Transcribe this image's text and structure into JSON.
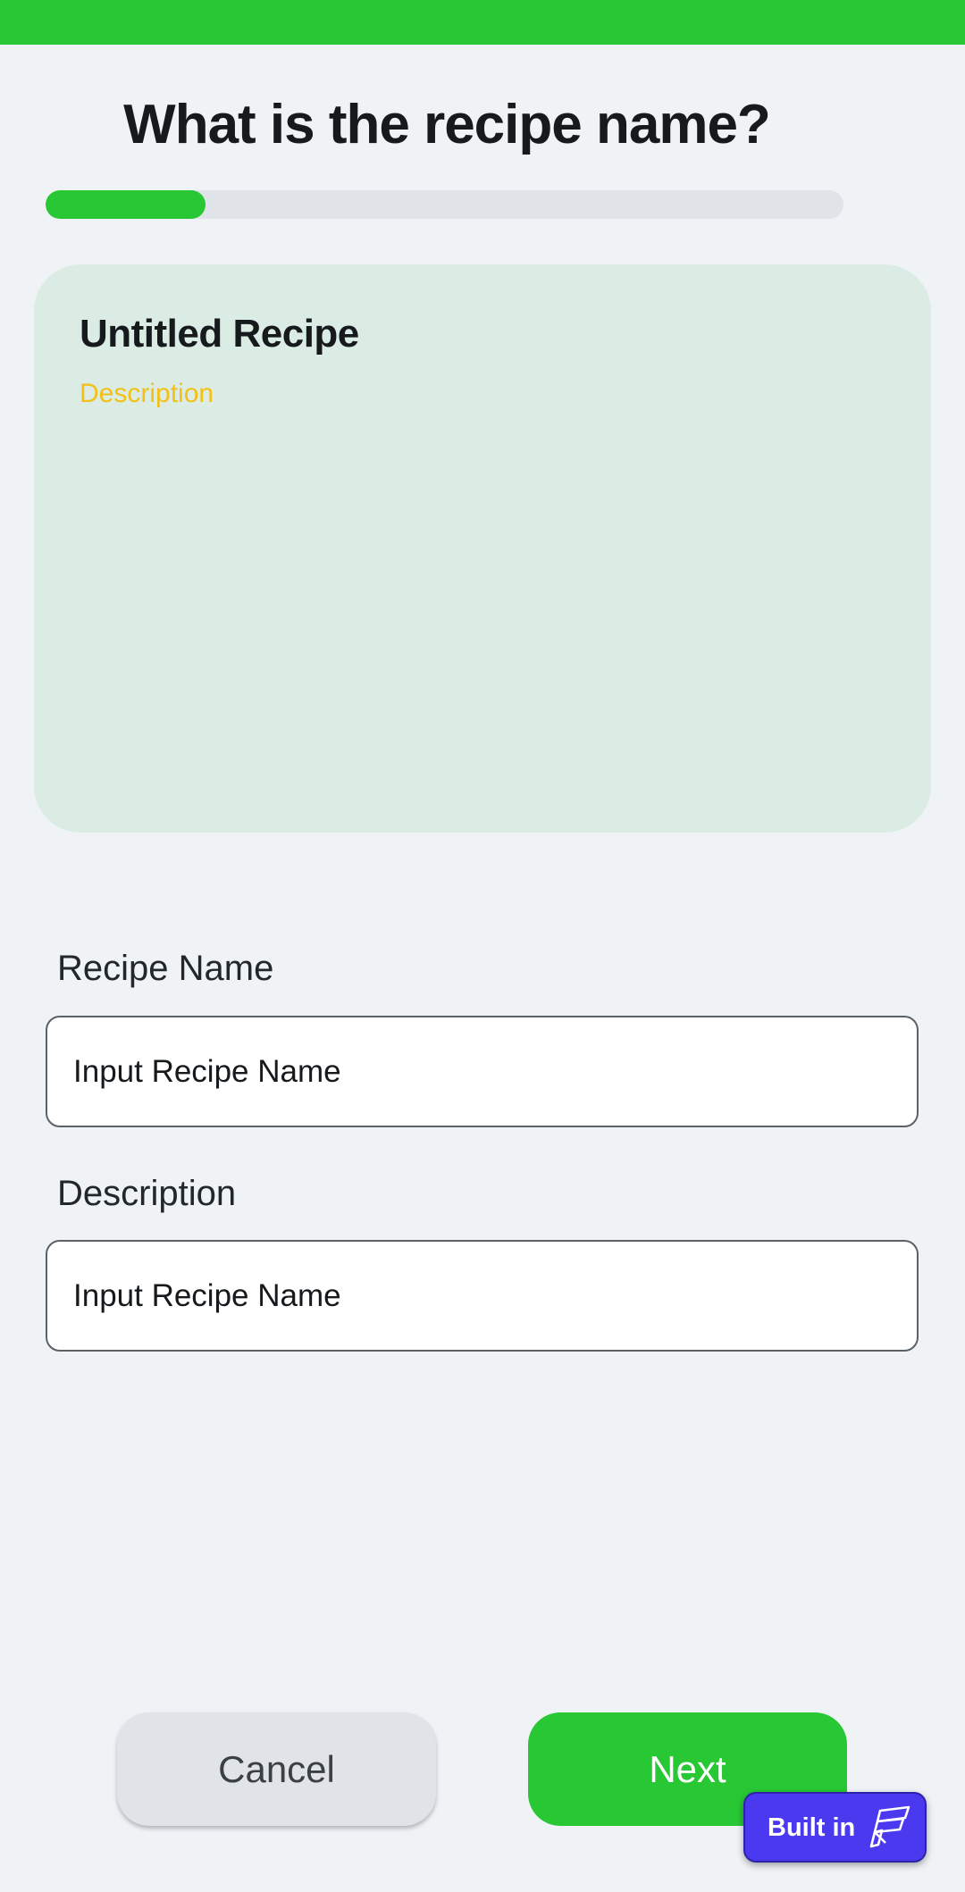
{
  "header": {
    "title": "What is the recipe name?",
    "accent_color": "#28c734"
  },
  "progress": {
    "fraction": 0.2
  },
  "preview": {
    "title": "Untitled Recipe",
    "description": "Description",
    "background_color": "#dbece4",
    "description_color": "#f2c016"
  },
  "form": {
    "recipe_name": {
      "label": "Recipe Name",
      "placeholder": "Input Recipe Name",
      "value": ""
    },
    "description": {
      "label": "Description",
      "placeholder": "Input Recipe Name",
      "value": ""
    }
  },
  "actions": {
    "cancel_label": "Cancel",
    "next_label": "Next"
  },
  "badge": {
    "label": "Built in",
    "icon": "flutterflow-logo-icon",
    "color": "#4b39ef"
  }
}
